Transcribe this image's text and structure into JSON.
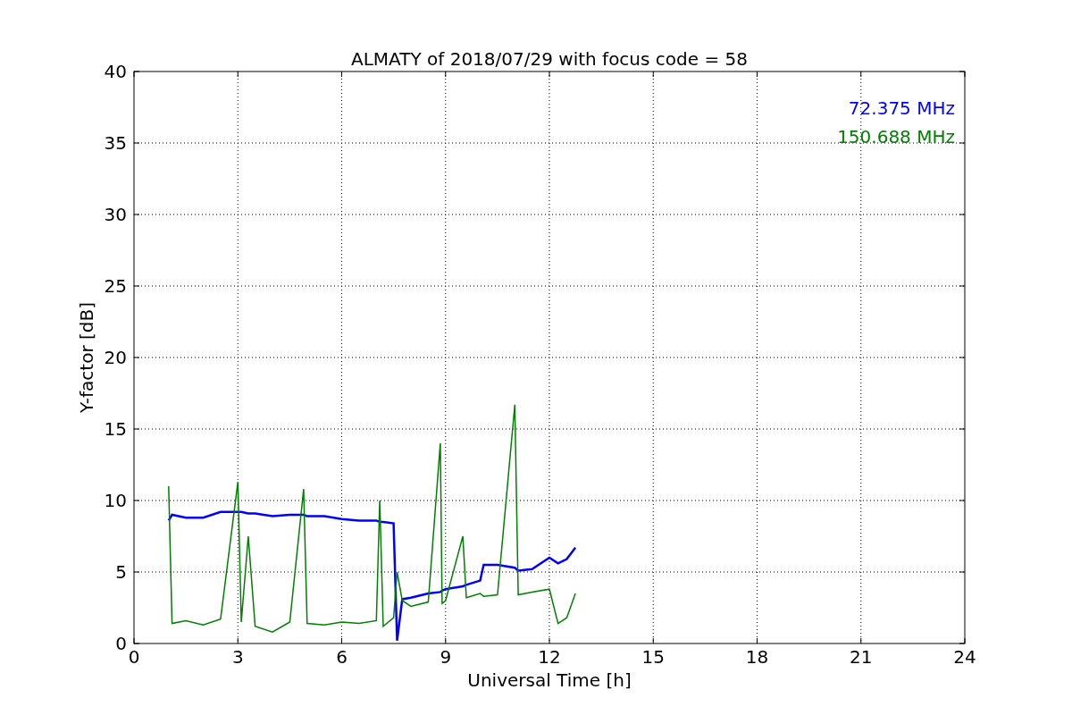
{
  "chart_data": {
    "type": "line",
    "title": "ALMATY of 2018/07/29 with focus code = 58",
    "xlabel": "Universal Time [h]",
    "ylabel": "Y-factor [dB]",
    "x": [
      1.0,
      1.1,
      1.5,
      2,
      2.5,
      3.0,
      3.1,
      3.3,
      3.5,
      4,
      4.5,
      4.9,
      5,
      5.5,
      6,
      6.5,
      7,
      7.1,
      7.2,
      7.5,
      7.6,
      7.75,
      8,
      8.5,
      8.85,
      8.9,
      9,
      9.5,
      9.6,
      10,
      10.1,
      10.5,
      11,
      11.1,
      11.5,
      12,
      12.25,
      12.5,
      12.75
    ],
    "series": [
      {
        "name": "72.375 MHz",
        "color": "#0000ff",
        "values": [
          8.6,
          9.0,
          8.8,
          8.8,
          9.2,
          9.2,
          9.2,
          9.1,
          9.1,
          8.9,
          9.0,
          9.0,
          8.9,
          8.9,
          8.7,
          8.6,
          8.6,
          8.5,
          8.5,
          8.4,
          0.2,
          3.1,
          3.2,
          3.5,
          3.6,
          3.7,
          3.8,
          4.0,
          4.1,
          4.4,
          5.5,
          5.5,
          5.3,
          5.1,
          5.2,
          6.0,
          5.6,
          5.9,
          6.7
        ]
      },
      {
        "name": "150.688 MHz",
        "color": "#008000",
        "values": [
          11.0,
          1.4,
          1.6,
          1.3,
          1.7,
          11.3,
          1.5,
          7.5,
          1.2,
          0.8,
          1.5,
          10.8,
          1.4,
          1.3,
          1.5,
          1.4,
          1.6,
          10.0,
          1.2,
          1.8,
          5.0,
          3.0,
          2.6,
          2.9,
          14.0,
          2.8,
          3.0,
          7.5,
          3.2,
          3.5,
          3.3,
          3.4,
          16.7,
          3.4,
          3.6,
          3.8,
          1.4,
          1.8,
          3.5
        ]
      }
    ],
    "xlim": [
      0,
      24
    ],
    "ylim": [
      0,
      40
    ],
    "xticks": [
      0,
      3,
      6,
      9,
      12,
      15,
      18,
      21,
      24
    ],
    "yticks": [
      0,
      5,
      10,
      15,
      20,
      25,
      30,
      35,
      40
    ],
    "grid": true
  }
}
